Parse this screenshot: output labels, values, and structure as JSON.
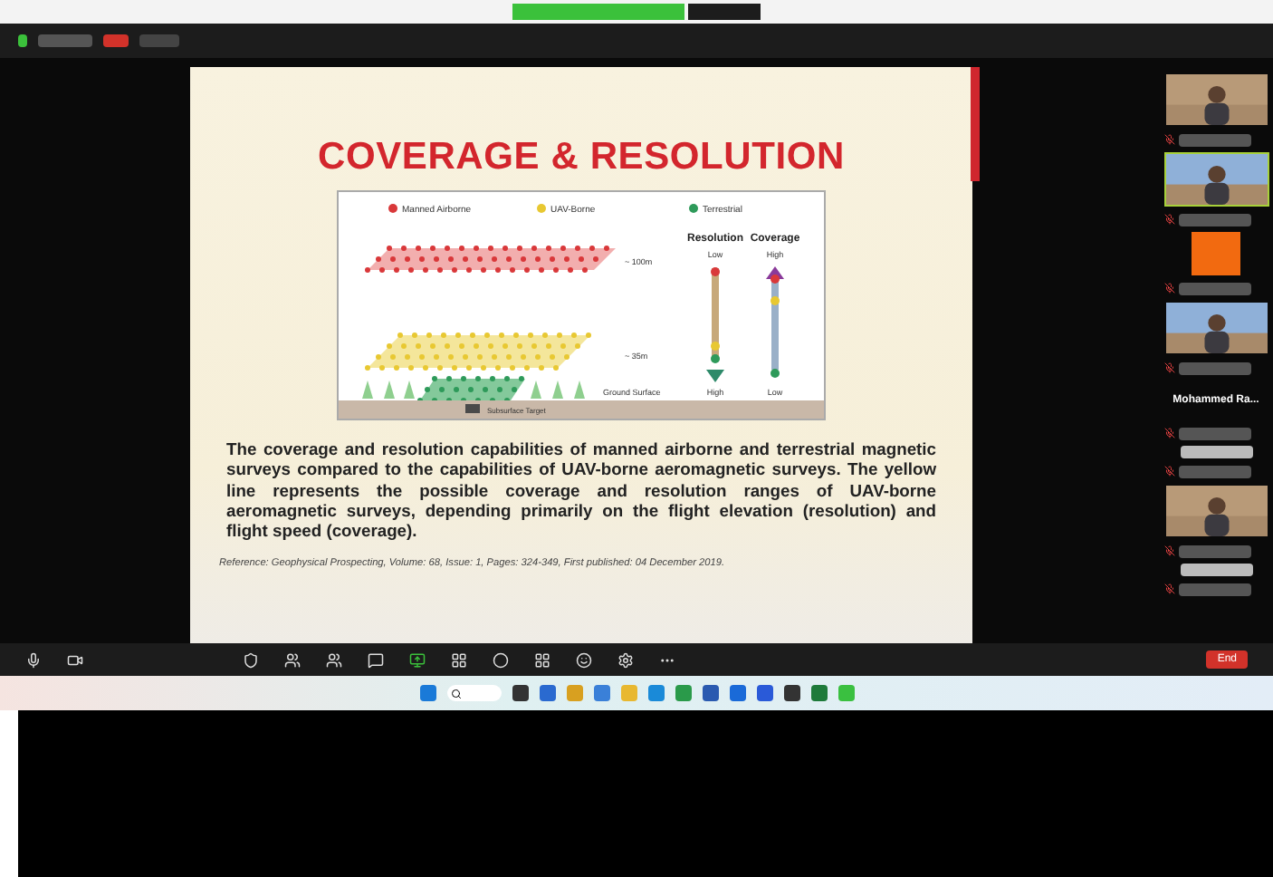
{
  "slide": {
    "title": "COVERAGE & RESOLUTION",
    "legend": [
      {
        "label": "Manned Airborne",
        "color": "#d9383a"
      },
      {
        "label": "UAV-Borne",
        "color": "#e8c832"
      },
      {
        "label": "Terrestrial",
        "color": "#2e9a5a"
      }
    ],
    "altitudes": [
      "~ 100m",
      "~ 35m"
    ],
    "ground_label": "Ground Surface",
    "target_label": "Subsurface Target",
    "scales": [
      {
        "title": "Resolution",
        "top": "Low",
        "bottom": "High",
        "kind": "down"
      },
      {
        "title": "Coverage",
        "top": "High",
        "bottom": "Low",
        "kind": "up"
      }
    ],
    "caption": "The coverage and resolution capabilities of manned airborne and terrestrial magnetic surveys compared to the capabilities of UAV-borne aeromagnetic surveys. The yellow line represents the possible coverage and resolution ranges of UAV-borne aeromagnetic surveys, depending primarily on the flight elevation (resolution) and flight speed (coverage).",
    "reference": "Reference: Geophysical Prospecting, Volume: 68, Issue: 1, Pages: 324-349, First published: 04 December 2019."
  },
  "participants": [
    {
      "kind": "video",
      "highlighted": false
    },
    {
      "kind": "video",
      "highlighted": true
    },
    {
      "kind": "avatar",
      "highlighted": false
    },
    {
      "kind": "video",
      "highlighted": false
    },
    {
      "kind": "name",
      "name": "Mohammed Ra...",
      "highlighted": false
    },
    {
      "kind": "blank",
      "highlighted": false
    },
    {
      "kind": "video",
      "highlighted": false
    },
    {
      "kind": "blank",
      "highlighted": false
    }
  ],
  "end_button": "End"
}
